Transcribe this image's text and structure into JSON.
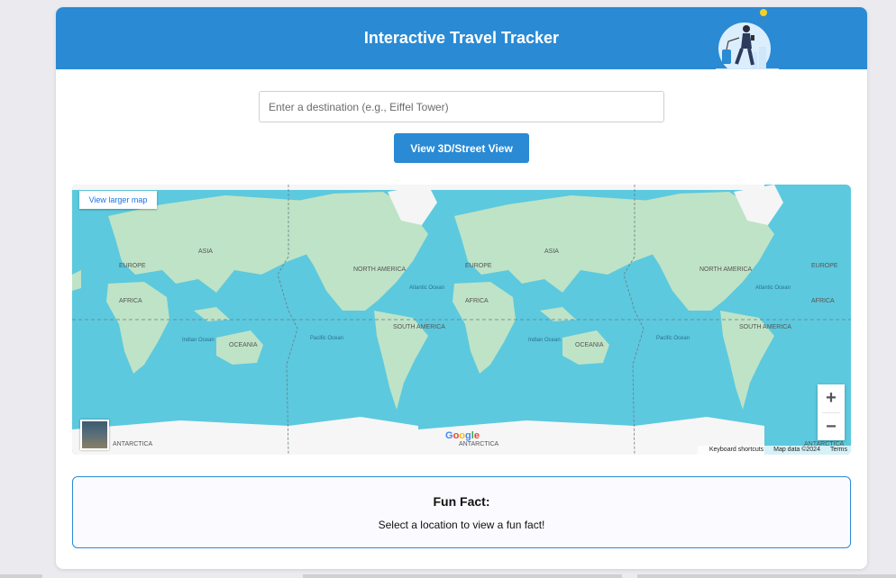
{
  "header": {
    "title": "Interactive Travel Tracker"
  },
  "search": {
    "placeholder": "Enter a destination (e.g., Eiffel Tower)",
    "value": ""
  },
  "actions": {
    "view_button_label": "View 3D/Street View"
  },
  "map": {
    "view_larger_label": "View larger map",
    "zoom_in_label": "+",
    "zoom_out_label": "−",
    "attribution": {
      "keyboard": "Keyboard shortcuts",
      "map_data": "Map data ©2024",
      "terms": "Terms"
    },
    "logo_text": "Google",
    "place_labels": {
      "europe": "EUROPE",
      "asia": "ASIA",
      "africa": "AFRICA",
      "north_america": "NORTH AMERICA",
      "south_america": "SOUTH AMERICA",
      "oceania": "OCEANIA",
      "antarctica": "ANTARCTICA",
      "atlantic": "Atlantic Ocean",
      "indian": "Indian Ocean",
      "pacific": "Pacific Ocean"
    }
  },
  "fun_fact": {
    "title": "Fun Fact:",
    "text": "Select a location to view a fun fact!"
  },
  "colors": {
    "primary": "#2a8ad4",
    "ocean": "#5cc9de",
    "land": "#bfe3c6",
    "page_bg": "#ebebef"
  },
  "icons": {
    "traveler_illustration": "traveler-with-luggage",
    "street_view": "pegman-thumbnail"
  }
}
